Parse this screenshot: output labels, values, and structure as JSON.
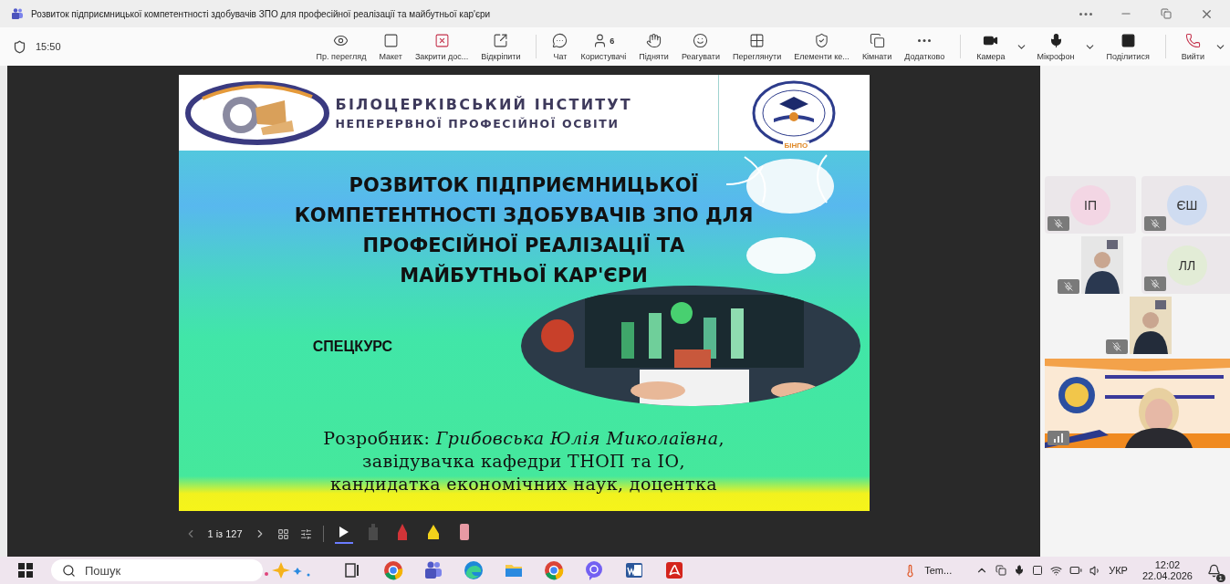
{
  "window": {
    "title": "Розвиток підприємницької компетентності здобувачів ЗПО для професійної реалізації та майбутньої кар'єри"
  },
  "meeting": {
    "time": "15:50"
  },
  "toolbar": {
    "groups": [
      {
        "items": [
          {
            "label": "Пр. перегляд",
            "kind": "tool",
            "dropdown": false
          },
          {
            "label": "Макет",
            "kind": "tool",
            "dropdown": false
          },
          {
            "label": "Закрити дос...",
            "kind": "stop",
            "dropdown": false
          },
          {
            "label": "Відкріпити",
            "kind": "tool",
            "dropdown": false
          }
        ]
      },
      {
        "items": [
          {
            "label": "Чат",
            "kind": "tool",
            "dropdown": false
          },
          {
            "label": "Користувачі",
            "kind": "tool",
            "dropdown": false,
            "badge": "6"
          },
          {
            "label": "Підняти",
            "kind": "tool",
            "dropdown": false
          },
          {
            "label": "Реагувати",
            "kind": "tool",
            "dropdown": false
          },
          {
            "label": "Переглянути",
            "kind": "tool",
            "dropdown": false
          },
          {
            "label": "Елементи ке...",
            "kind": "tool",
            "dropdown": false
          },
          {
            "label": "Кімнати",
            "kind": "tool",
            "dropdown": false
          },
          {
            "label": "Додатково",
            "kind": "tool",
            "dropdown": false
          }
        ]
      },
      {
        "items": [
          {
            "label": "Камера",
            "kind": "media",
            "dropdown": true
          },
          {
            "label": "Мікрофон",
            "kind": "media",
            "dropdown": true
          },
          {
            "label": "Поділитися",
            "kind": "media",
            "dropdown": false
          }
        ]
      },
      {
        "items": [
          {
            "label": "Вийти",
            "kind": "leave",
            "dropdown": true
          }
        ]
      }
    ]
  },
  "slide": {
    "logo_text": [
      "БІЛОЦЕРКІВСЬКИЙ  ІНСТИТУТ",
      "НЕПЕРЕРВНОЇ ПРОФЕСІЙНОЇ ОСВІТИ"
    ],
    "emblem_label": "БІНПО",
    "title": [
      "РОЗВИТОК ПІДПРИЄМНИЦЬКОЇ",
      "КОМПЕТЕНТНОСТІ ЗДОБУВАЧІВ ЗПО ДЛЯ",
      "ПРОФЕСІЙНОЇ РЕАЛІЗАЦІЇ ТА",
      "МАЙБУТНЬОЇ КАР'ЄРИ"
    ],
    "subtitle": "СПЕЦКУРС",
    "image": {
      "kind": "picture"
    },
    "author": [
      "Розробник: *Грибовська  Юлія Миколаївна*,",
      "завідувачка кафедри ТНОП та ІО,",
      "кандидатка економічних наук, доцентка"
    ]
  },
  "slide_controls": {
    "page": "1 із 127",
    "tools": [
      {
        "kind": "pointer",
        "selected": true
      },
      {
        "kind": "laser",
        "color": "#4a4a4a",
        "selected": false
      },
      {
        "kind": "pen",
        "color": "#d13438",
        "selected": false
      },
      {
        "kind": "highlighter",
        "color": "#f2d21b",
        "selected": false
      },
      {
        "kind": "eraser",
        "color": "#e89aa4",
        "selected": false
      }
    ]
  },
  "participant_rows": [
    [
      {
        "kind": "avatar",
        "initials": "ІП",
        "color": "#f3d6e4",
        "muted": true
      },
      {
        "kind": "avatar",
        "initials": "ЄШ",
        "color": "#cfdcf1",
        "muted": true
      }
    ],
    [
      {
        "kind": "video",
        "muted": true
      },
      {
        "kind": "avatar",
        "initials": "ЛЛ",
        "color": "#e2ecd6",
        "muted": true
      }
    ],
    [
      {
        "kind": "video",
        "muted": true
      }
    ]
  ],
  "presenter": {
    "kind": "video",
    "muted": false
  },
  "taskbar": {
    "search": {
      "placeholder": "Пошук"
    },
    "apps": [
      {
        "kind": "taskview"
      },
      {
        "kind": "chrome"
      },
      {
        "kind": "teams"
      },
      {
        "kind": "edge"
      },
      {
        "kind": "folder"
      },
      {
        "kind": "chrome"
      },
      {
        "kind": "viber"
      },
      {
        "kind": "word"
      },
      {
        "kind": "acrobat"
      }
    ],
    "weather": "Tem...",
    "language": "УКР",
    "time": "12:02",
    "date": "22.04.2026",
    "notifications": "1"
  }
}
